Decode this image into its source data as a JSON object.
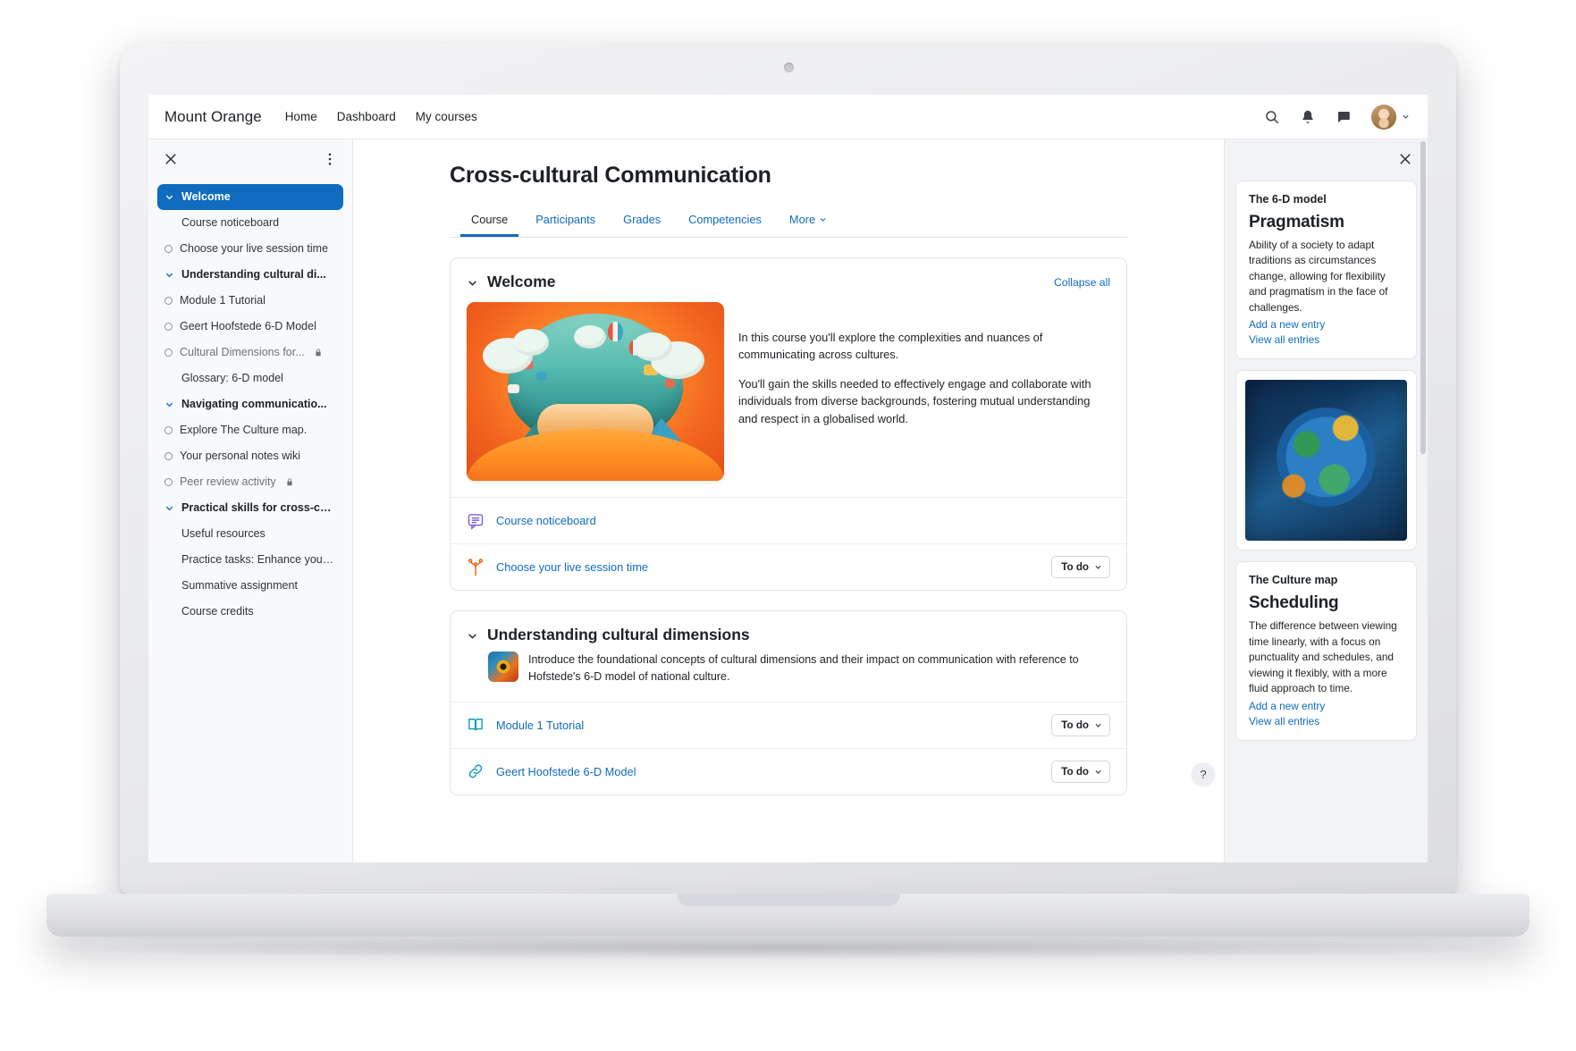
{
  "navbar": {
    "brand": "Mount Orange",
    "links": [
      {
        "label": "Home"
      },
      {
        "label": "Dashboard"
      },
      {
        "label": "My courses"
      }
    ],
    "icons": [
      "search-icon",
      "notifications-bell-icon",
      "messages-icon"
    ]
  },
  "course_index": {
    "items": [
      {
        "label": "Welcome",
        "type": "section",
        "active": true,
        "marker": "chevron"
      },
      {
        "label": "Course noticeboard",
        "type": "activity",
        "marker": "none"
      },
      {
        "label": "Choose your live session time",
        "type": "activity",
        "marker": "circle"
      },
      {
        "label": "Understanding cultural di...",
        "type": "section",
        "marker": "chevron"
      },
      {
        "label": "Module 1 Tutorial",
        "type": "activity",
        "marker": "circle"
      },
      {
        "label": "Geert Hoofstede 6-D Model",
        "type": "activity",
        "marker": "circle"
      },
      {
        "label": "Cultural Dimensions for...",
        "type": "activity",
        "marker": "circle",
        "locked": true,
        "dim": true
      },
      {
        "label": "Glossary: 6-D model",
        "type": "activity",
        "marker": "none"
      },
      {
        "label": "Navigating communicatio...",
        "type": "section",
        "marker": "chevron"
      },
      {
        "label": "Explore The Culture map.",
        "type": "activity",
        "marker": "circle"
      },
      {
        "label": "Your personal notes wiki",
        "type": "activity",
        "marker": "circle"
      },
      {
        "label": "Peer review activity",
        "type": "activity",
        "marker": "circle",
        "locked": true,
        "dim": true
      },
      {
        "label": "Practical skills for cross-cul...",
        "type": "section",
        "marker": "chevron"
      },
      {
        "label": "Useful resources",
        "type": "activity",
        "marker": "none"
      },
      {
        "label": "Practice tasks: Enhance your ...",
        "type": "activity",
        "marker": "none"
      },
      {
        "label": "Summative assignment",
        "type": "activity",
        "marker": "none"
      },
      {
        "label": "Course credits",
        "type": "activity",
        "marker": "none"
      }
    ]
  },
  "main": {
    "page_title": "Cross-cultural Communication",
    "tabs": [
      {
        "label": "Course",
        "active": true,
        "caret": false
      },
      {
        "label": "Participants",
        "active": false,
        "caret": false
      },
      {
        "label": "Grades",
        "active": false,
        "caret": false
      },
      {
        "label": "Competencies",
        "active": false,
        "caret": false
      },
      {
        "label": "More",
        "active": false,
        "caret": true
      }
    ],
    "welcome_section": {
      "title": "Welcome",
      "collapse_all": "Collapse all",
      "paragraph_1": "In this course you'll explore the complexities and nuances of communicating across cultures.",
      "paragraph_2": "You'll gain the skills needed to effectively engage and collaborate with individuals from diverse backgrounds, fostering mutual understanding and respect in a globalised world.",
      "activities": [
        {
          "name": "Course noticeboard",
          "icon": "forum-icon",
          "todo": null
        },
        {
          "name": "Choose your live session time",
          "icon": "choice-icon",
          "todo": "To do"
        }
      ]
    },
    "dimensions_section": {
      "title": "Understanding cultural dimensions",
      "description": "Introduce the foundational concepts of cultural dimensions and their impact on communication with reference to Hofstede's 6-D model of national culture.",
      "activities": [
        {
          "name": "Module 1 Tutorial",
          "icon": "book-icon",
          "todo": "To do"
        },
        {
          "name": "Geert Hoofstede 6-D Model",
          "icon": "url-link-icon",
          "todo": "To do"
        }
      ]
    },
    "help_button": "?"
  },
  "blocks": [
    {
      "kind": "glossary",
      "title": "The 6-D model",
      "term": "Pragmatism",
      "definition": "Ability of a society to adapt traditions as circumstances change, allowing for flexibility and pragmatism in the face of challenges.",
      "add_link": "Add a new entry",
      "view_link": "View all entries"
    },
    {
      "kind": "image",
      "alt": "colourful-globe-image"
    },
    {
      "kind": "glossary",
      "title": "The Culture map",
      "term": "Scheduling",
      "definition": "The difference between viewing time linearly, with a focus on punctuality and schedules, and viewing it flexibly, with a more fluid approach to time.",
      "add_link": "Add a new entry",
      "view_link": "View all entries"
    }
  ],
  "colors": {
    "primary": "#0f6cbf",
    "text": "#1d2125",
    "muted": "#6c7278",
    "drawer_bg": "#f8f9fa",
    "blocks_bg": "#f2f3f5",
    "border": "#e4e5e9",
    "forum_icon": "#7b5cd6",
    "choice_icon": "#e8661e",
    "book_icon": "#0f9fb5",
    "url_icon": "#0f9fb5"
  }
}
